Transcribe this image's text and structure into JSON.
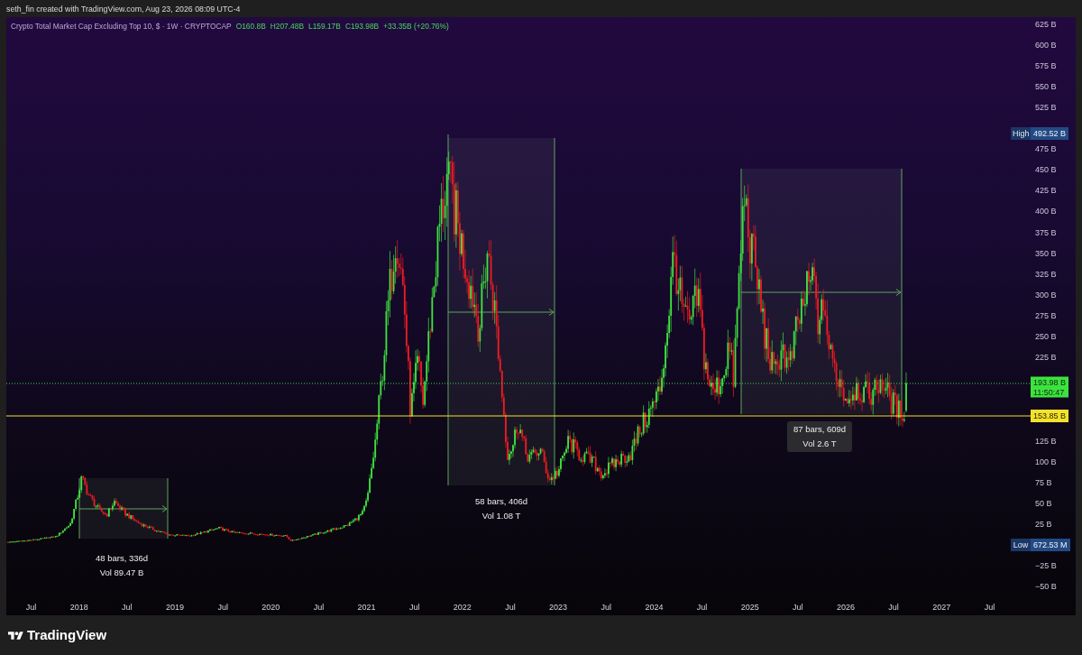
{
  "credit": "seth_fin created with TradingView.com, Aug 23, 2026 08:09 UTC-4",
  "legend": {
    "symbol": "Crypto Total Market Cap Excluding Top 10, $ · 1W · CRYPTOCAP",
    "values": [
      "O160.8B",
      "H207.48B",
      "L159.17B",
      "C193.98B",
      "+33.35B (+20.76%)"
    ]
  },
  "price_axis": {
    "ticks": [
      "625 B",
      "600 B",
      "575 B",
      "550 B",
      "525 B",
      "475 B",
      "450 B",
      "425 B",
      "400 B",
      "375 B",
      "350 B",
      "325 B",
      "300 B",
      "275 B",
      "250 B",
      "225 B",
      "125 B",
      "100 B",
      "75 B",
      "50 B",
      "25 B",
      "−25 B",
      "−50 B"
    ],
    "markers": [
      {
        "kind": "high",
        "tag": "High",
        "value": "492.52 B"
      },
      {
        "kind": "last",
        "value": "193.98 B",
        "countdown": "11:50:47"
      },
      {
        "kind": "line",
        "value": "153.85 B"
      },
      {
        "kind": "low",
        "tag": "Low",
        "value": "672.53 M"
      }
    ]
  },
  "measurements": [
    {
      "bars": "48 bars, 336d",
      "volume": "Vol 89.47 B",
      "label_background": false
    },
    {
      "bars": "58 bars, 406d",
      "volume": "Vol 1.08 T",
      "label_background": false
    },
    {
      "bars": "87 bars, 609d",
      "volume": "Vol 2.6 T",
      "label_background": true
    }
  ],
  "time_axis": {
    "ticks": [
      "Jul",
      "2018",
      "Jul",
      "2019",
      "Jul",
      "2020",
      "Jul",
      "2021",
      "Jul",
      "2022",
      "Jul",
      "2023",
      "Jul",
      "2024",
      "Jul",
      "2025",
      "Jul",
      "2026",
      "Jul",
      "2027",
      "Jul"
    ]
  },
  "footer": {
    "logo": "TradingView"
  }
}
